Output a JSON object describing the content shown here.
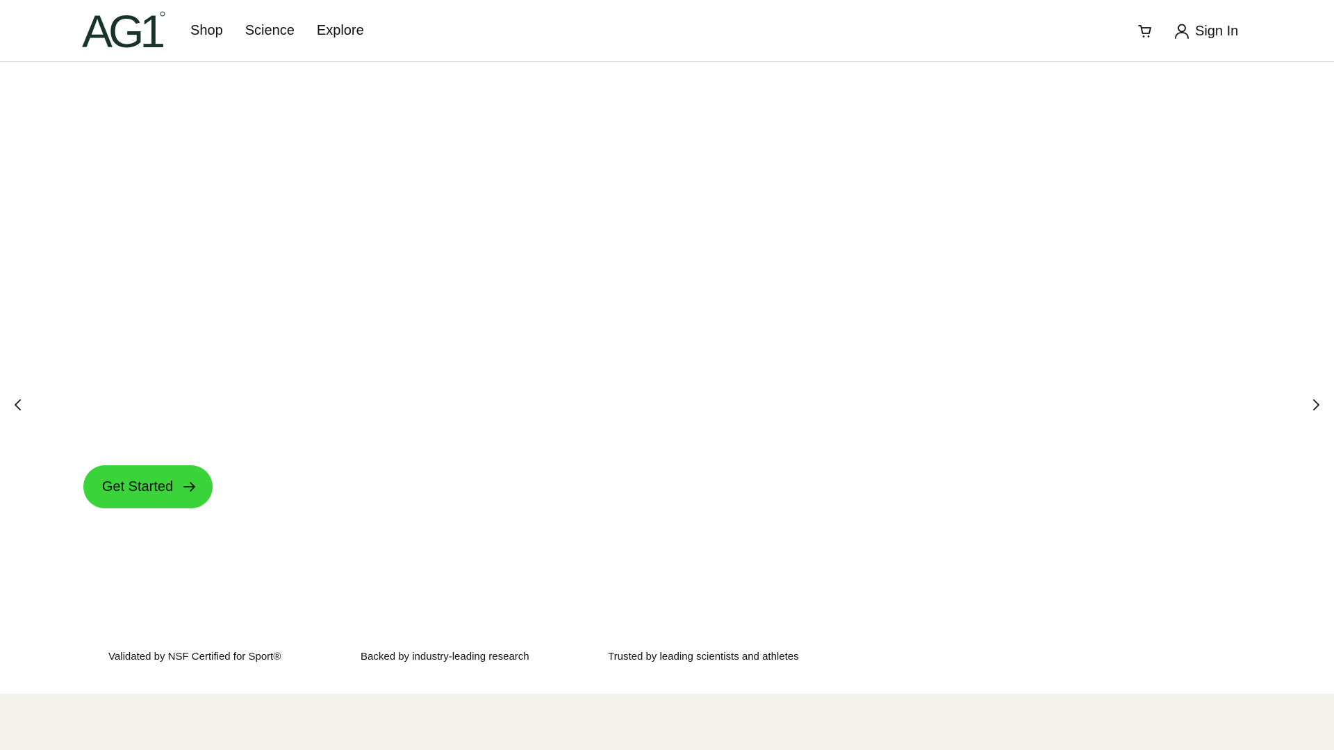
{
  "brand": {
    "logo_text": "AG1",
    "colors": {
      "logo": "#17332b",
      "cta": "#3ad43a",
      "footer_band": "#f3f2ed"
    }
  },
  "header": {
    "nav": [
      {
        "label": "Shop"
      },
      {
        "label": "Science"
      },
      {
        "label": "Explore"
      }
    ],
    "cart_icon": "cart-icon",
    "signin_icon": "user-icon",
    "signin_label": "Sign In"
  },
  "hero": {
    "prev_icon": "chevron-left-icon",
    "next_icon": "chevron-right-icon",
    "cta_label": "Get Started",
    "cta_icon": "arrow-right-icon"
  },
  "trust_badges": [
    {
      "text": "Validated by NSF Certified for Sport®"
    },
    {
      "text": "Backed by industry-leading research"
    },
    {
      "text": "Trusted by leading scientists and athletes"
    }
  ]
}
